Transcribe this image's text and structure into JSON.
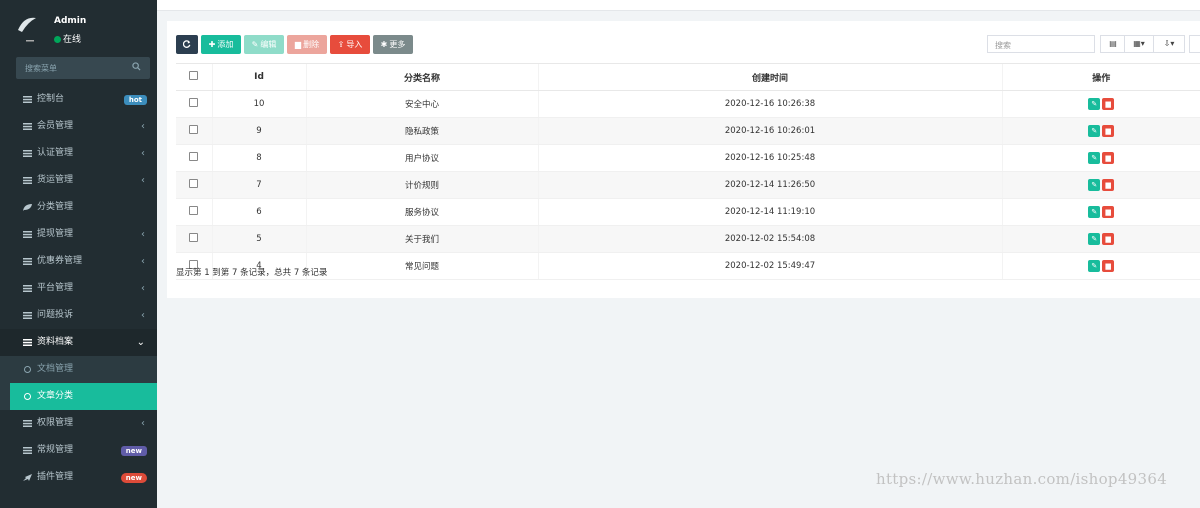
{
  "user": {
    "name": "Admin",
    "status": "在线"
  },
  "sidebar": {
    "search_placeholder": "搜索菜单",
    "items": [
      {
        "label": "控制台",
        "icon": "dashboard-icon",
        "badge": "hot"
      },
      {
        "label": "会员管理",
        "icon": "list-icon"
      },
      {
        "label": "认证管理",
        "icon": "list-icon"
      },
      {
        "label": "货运管理",
        "icon": "list-icon"
      },
      {
        "label": "分类管理",
        "icon": "leaf-icon"
      },
      {
        "label": "提现管理",
        "icon": "list-icon"
      },
      {
        "label": "优惠券管理",
        "icon": "list-icon"
      },
      {
        "label": "平台管理",
        "icon": "list-icon"
      },
      {
        "label": "问题投诉",
        "icon": "list-icon"
      },
      {
        "label": "资料档案",
        "icon": "list-icon",
        "open": true
      }
    ],
    "subitems": [
      {
        "label": "文档管理"
      },
      {
        "label": "文章分类",
        "active": true
      }
    ],
    "items_after": [
      {
        "label": "权限管理",
        "icon": "list-icon"
      },
      {
        "label": "常规管理",
        "icon": "list-icon",
        "badge": "new"
      },
      {
        "label": "插件管理",
        "icon": "rocket-icon",
        "badge": "new"
      }
    ]
  },
  "toolbar": {
    "add": "添加",
    "edit": "编辑",
    "delete": "删除",
    "import": "导入",
    "more": "更多",
    "search_placeholder": "搜索"
  },
  "table": {
    "columns": [
      "Id",
      "分类名称",
      "创建时间",
      "操作"
    ],
    "rows": [
      {
        "id": "10",
        "name": "安全中心",
        "created": "2020-12-16 10:26:38"
      },
      {
        "id": "9",
        "name": "隐私政策",
        "created": "2020-12-16 10:26:01"
      },
      {
        "id": "8",
        "name": "用户协议",
        "created": "2020-12-16 10:25:48"
      },
      {
        "id": "7",
        "name": "计价规则",
        "created": "2020-12-14 11:26:50"
      },
      {
        "id": "6",
        "name": "服务协议",
        "created": "2020-12-14 11:19:10"
      },
      {
        "id": "5",
        "name": "关于我们",
        "created": "2020-12-02 15:54:08"
      },
      {
        "id": "4",
        "name": "常见问题",
        "created": "2020-12-02 15:49:47"
      }
    ]
  },
  "pagination_text": "显示第 1 到第 7 条记录，总共 7 条记录",
  "watermark": "https://www.huzhan.com/ishop49364",
  "colors": {
    "sidebar": "#222d32",
    "accent": "#18bc9c",
    "danger": "#e74c3c"
  }
}
